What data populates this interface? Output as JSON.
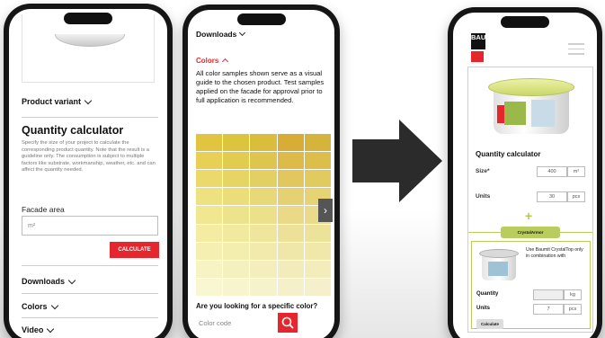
{
  "phone1": {
    "product_variant_label": "Product variant",
    "quantity_title": "Quantity calculator",
    "description": "Specify the size of your project to calculate the corresponding product quantity. Note that the result is a guideline only. The consumption is subject to multiple factors like substrate, workmanship, weather, etc. and can affect the quantity needed.",
    "facade_label": "Facade area",
    "facade_placeholder": "m²",
    "calculate_button": "CALCULATE",
    "sections": [
      "Downloads",
      "Colors",
      "Video"
    ]
  },
  "phone2": {
    "downloads_label": "Downloads",
    "colors_label": "Colors",
    "colors_text": "All color samples shown serve as a visual guide to the chosen product. Test samples applied on the facade for approval prior to full application is recommended.",
    "swatches": [
      "#e1c541",
      "#dcc43d",
      "#d9bd3b",
      "#d8ad36",
      "#d4b43b",
      "#e7d055",
      "#e2cc50",
      "#dec64e",
      "#dcbb48",
      "#dcbf4a",
      "#ebda6b",
      "#e6d565",
      "#e3d063",
      "#e1c75d",
      "#e1ca5e",
      "#eee17f",
      "#ebdd7a",
      "#e8d878",
      "#e6d172",
      "#e6d374",
      "#f1e791",
      "#eee38d",
      "#ece08b",
      "#ead987",
      "#eadb88",
      "#f3eca2",
      "#f1e99e",
      "#efe59c",
      "#ede098",
      "#ede29a",
      "#f5f0b2",
      "#f3edae",
      "#f1eaac",
      "#efe6a9",
      "#f0e8ab",
      "#f7f3c2",
      "#f5f1be",
      "#f4eebc",
      "#f2ebba",
      "#f3ecbb",
      "#f9f6d2",
      "#f7f4ce",
      "#f6f2cc",
      "#f5efca",
      "#f5f0cb"
    ],
    "next_icon": "›",
    "search_question": "Are you looking for a specific color?",
    "color_code_placeholder": "Color code"
  },
  "phone3": {
    "logo_text": "BAU",
    "quantity_title": "Quantity calculator",
    "size_label": "Size*",
    "size_value": "400",
    "size_unit": "m²",
    "units_label": "Units",
    "units_value": "30",
    "units_unit": "pcs",
    "plus_symbol": "+",
    "crystal_button": "CrystalArmor",
    "combine_text": "Use Baumit CrystalTop only in combination with",
    "quantity_label": "Quantity",
    "quantity_unit": "kg",
    "units2_label": "Units",
    "units2_value": "7",
    "units2_unit": "pcs",
    "calculate_button": "Calculate"
  },
  "colors": {
    "accent_red": "#e5272d",
    "accent_green": "#b9cc5e"
  }
}
